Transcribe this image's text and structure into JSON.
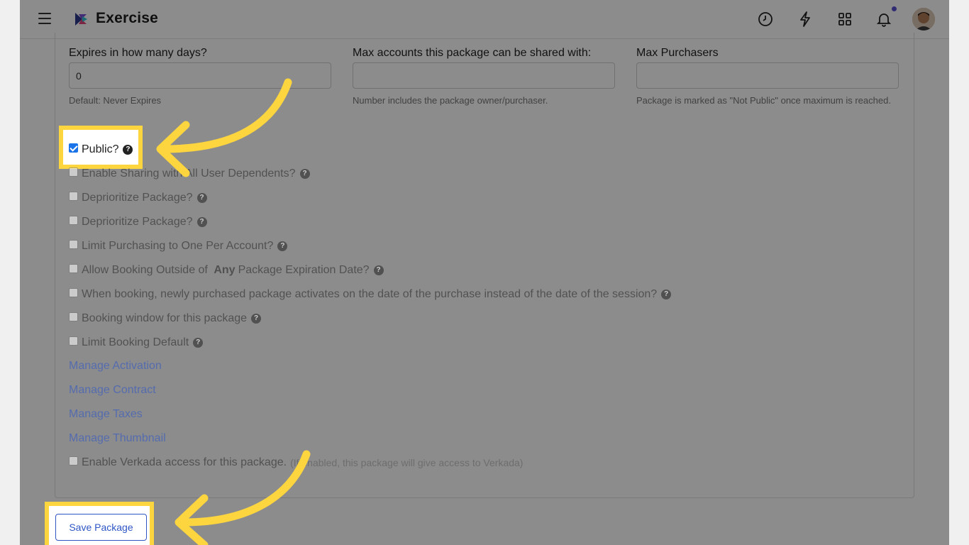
{
  "header": {
    "app_title": "Exercise",
    "icons": [
      "menu-icon",
      "history-icon",
      "bolt-icon",
      "apps-grid-icon",
      "bell-icon"
    ]
  },
  "fields": {
    "expires": {
      "label": "Expires in how many days?",
      "value": "0",
      "help": "Default: Never Expires"
    },
    "max_accounts": {
      "label": "Max accounts this package can be shared with:",
      "value": "",
      "help": "Number includes the package owner/purchaser."
    },
    "max_purchasers": {
      "label": "Max Purchasers",
      "value": "",
      "help": "Package is marked as \"Not Public\" once maximum is reached."
    }
  },
  "options": [
    {
      "label": "Public?",
      "checked": true
    },
    {
      "label": "Enable Sharing with All User Dependents?",
      "checked": false
    },
    {
      "label": "Deprioritize Package?",
      "checked": false
    },
    {
      "label": "Deprioritize Package?",
      "checked": false
    },
    {
      "label": "Limit Purchasing to One Per Account?",
      "checked": false
    },
    {
      "label_pre": "Allow Booking Outside of ",
      "label_bold": "Any",
      "label_post": " Package Expiration Date?",
      "checked": false
    },
    {
      "label": "When booking, newly purchased package activates on the date of the purchase instead of the date of the session?",
      "checked": false
    },
    {
      "label": "Booking window for this package",
      "checked": false
    },
    {
      "label": "Limit Booking Default",
      "checked": false
    }
  ],
  "links": [
    "Manage Activation",
    "Manage Contract",
    "Manage Taxes",
    "Manage Thumbnail"
  ],
  "verkada": {
    "label": "Enable Verkada access for this package.",
    "note": "(If enabled, this package will give access to Verkada)",
    "checked": false
  },
  "save_label": "Save Package",
  "colors": {
    "highlight": "#fcd53f",
    "link": "#2f56c6",
    "checkbox": "#1a73e8"
  }
}
